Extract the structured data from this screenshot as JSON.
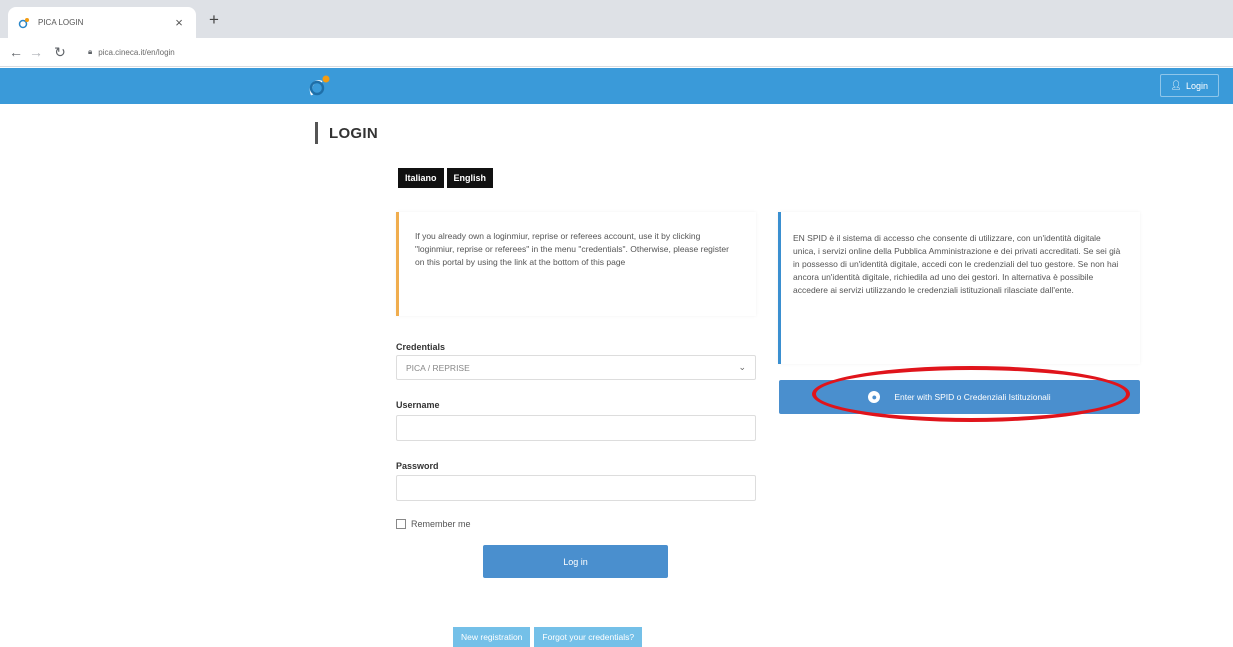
{
  "browser": {
    "tab_title": "PICA LOGIN",
    "tab_close": "×",
    "new_tab": "+",
    "url": "pica.cineca.it/en/login"
  },
  "header": {
    "login_label": "Login"
  },
  "page": {
    "title": "LOGIN",
    "languages": [
      "Italiano",
      "English"
    ]
  },
  "info_left": "If you already own a loginmiur, reprise or referees account, use it by clicking \"loginmiur, reprise or referees\" in the menu \"credentials\". Otherwise, please register on this portal by using the link at the bottom of this page",
  "form": {
    "credentials_label": "Credentials",
    "credentials_value": "PICA / REPRISE",
    "username_label": "Username",
    "password_label": "Password",
    "remember_label": "Remember me",
    "login_button": "Log in"
  },
  "bottom": {
    "new_registration": "New registration",
    "forgot": "Forgot your credentials?"
  },
  "info_right": "EN SPID è il sistema di accesso che consente di utilizzare, con un'identità digitale unica, i servizi online della Pubblica Amministrazione e dei privati accreditati. Se sei già in possesso di un'identità digitale, accedi con le credenziali del tuo gestore. Se non hai ancora un'identità digitale, richiedila ad uno dei gestori. In alternativa è possibile accedere ai servizi utilizzando le credenziali istituzionali rilasciate dall'ente.",
  "spid_button": "Enter with SPID o Credenziali Istituzionali",
  "colors": {
    "header": "#3a9ad9",
    "button": "#4a8fce",
    "highlight": "#e0141b",
    "warning_border": "#f0ad4e"
  }
}
